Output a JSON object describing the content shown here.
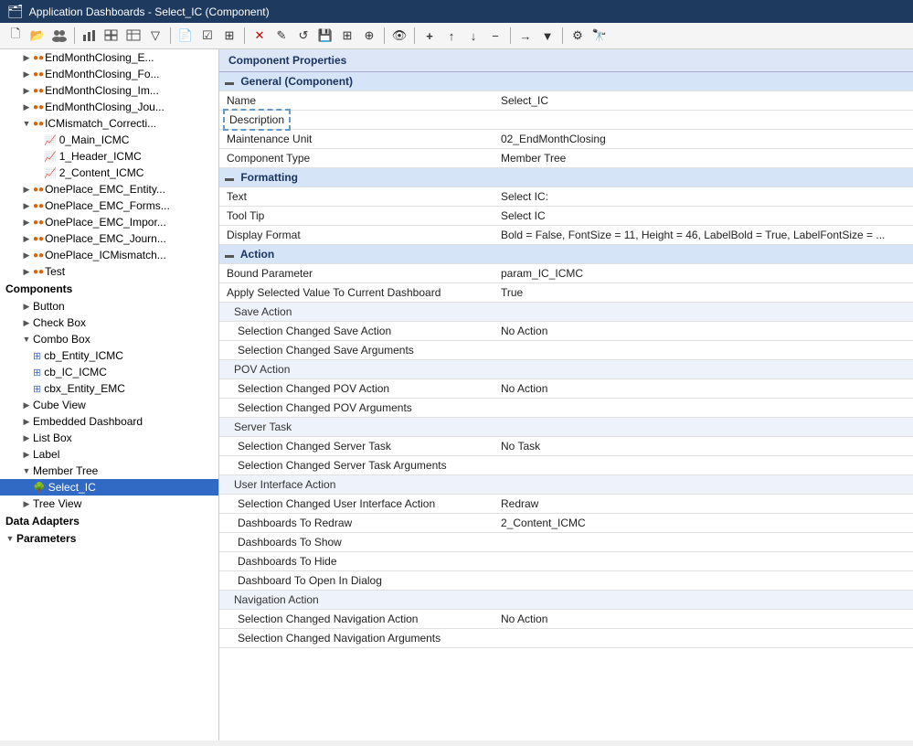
{
  "titleBar": {
    "icon": "🗂",
    "title": "Application Dashboards - Select_IC (Component)"
  },
  "toolbar": {
    "buttons": [
      {
        "name": "new",
        "icon": "🗋",
        "label": "New"
      },
      {
        "name": "open",
        "icon": "📂",
        "label": "Open"
      },
      {
        "name": "users",
        "icon": "👥",
        "label": "Users"
      },
      {
        "name": "separator1",
        "icon": "|"
      },
      {
        "name": "chart",
        "icon": "📊",
        "label": "Chart"
      },
      {
        "name": "grid",
        "icon": "⊞",
        "label": "Grid"
      },
      {
        "name": "table",
        "icon": "⊟",
        "label": "Table"
      },
      {
        "name": "filter",
        "icon": "▽",
        "label": "Filter"
      },
      {
        "name": "separator2",
        "icon": "|"
      },
      {
        "name": "doc",
        "icon": "📄",
        "label": "Document"
      },
      {
        "name": "checklist",
        "icon": "☑",
        "label": "Checklist"
      },
      {
        "name": "grid2",
        "icon": "⊞",
        "label": "Grid2"
      },
      {
        "name": "separator3",
        "icon": "|"
      },
      {
        "name": "delete",
        "icon": "✕",
        "label": "Delete"
      },
      {
        "name": "edit",
        "icon": "✎",
        "label": "Edit"
      },
      {
        "name": "refresh",
        "icon": "↺",
        "label": "Refresh"
      },
      {
        "name": "save",
        "icon": "💾",
        "label": "Save"
      },
      {
        "name": "saveall",
        "icon": "⊞",
        "label": "SaveAll"
      },
      {
        "name": "copy",
        "icon": "⊕",
        "label": "Copy"
      },
      {
        "name": "separator4",
        "icon": "|"
      },
      {
        "name": "eye",
        "icon": "👁",
        "label": "Preview"
      },
      {
        "name": "separator5",
        "icon": "|"
      },
      {
        "name": "add",
        "icon": "+",
        "label": "Add"
      },
      {
        "name": "up",
        "icon": "↑",
        "label": "Up"
      },
      {
        "name": "down",
        "icon": "↓",
        "label": "Down"
      },
      {
        "name": "minus",
        "icon": "−",
        "label": "Remove"
      },
      {
        "name": "separator6",
        "icon": "|"
      },
      {
        "name": "arrow",
        "icon": "→",
        "label": "Arrow"
      },
      {
        "name": "dropdown",
        "icon": "▼",
        "label": "Dropdown"
      },
      {
        "name": "separator7",
        "icon": "|"
      },
      {
        "name": "settings",
        "icon": "⚙",
        "label": "Settings"
      },
      {
        "name": "binoculars",
        "icon": "🔭",
        "label": "Binoculars"
      }
    ]
  },
  "tree": {
    "items": [
      {
        "id": "EndMonthClosing_E",
        "label": "EndMonthClosing_E...",
        "indent": 1,
        "type": "dots",
        "hasArrow": true,
        "expanded": false
      },
      {
        "id": "EndMonthClosing_F",
        "label": "EndMonthClosing_F...",
        "indent": 1,
        "type": "dots",
        "hasArrow": true,
        "expanded": false
      },
      {
        "id": "EndMonthClosing_Im",
        "label": "EndMonthClosing_Im...",
        "indent": 1,
        "type": "dots",
        "hasArrow": true,
        "expanded": false
      },
      {
        "id": "EndMonthClosing_Jo",
        "label": "EndMonthClosing_Jo...",
        "indent": 1,
        "type": "dots",
        "hasArrow": true,
        "expanded": false
      },
      {
        "id": "ICMismatch_Correcti",
        "label": "ICMismatch_Correcti...",
        "indent": 1,
        "type": "dots",
        "hasArrow": true,
        "expanded": true
      },
      {
        "id": "0_Main_ICMC",
        "label": "0_Main_ICMC",
        "indent": 2,
        "type": "chart",
        "hasArrow": false
      },
      {
        "id": "1_Header_ICMC",
        "label": "1_Header_ICMC",
        "indent": 2,
        "type": "chart",
        "hasArrow": false
      },
      {
        "id": "2_Content_ICMC",
        "label": "2_Content_ICMC",
        "indent": 2,
        "type": "chart",
        "hasArrow": false
      },
      {
        "id": "OnePlace_EMC_Entity",
        "label": "OnePlace_EMC_Entity...",
        "indent": 1,
        "type": "dots",
        "hasArrow": true,
        "expanded": false
      },
      {
        "id": "OnePlace_EMC_Forms",
        "label": "OnePlace_EMC_Forms...",
        "indent": 1,
        "type": "dots",
        "hasArrow": true,
        "expanded": false
      },
      {
        "id": "OnePlace_EMC_Impor",
        "label": "OnePlace_EMC_Impor...",
        "indent": 1,
        "type": "dots",
        "hasArrow": true,
        "expanded": false
      },
      {
        "id": "OnePlace_EMC_Journ",
        "label": "OnePlace_EMC_Journ...",
        "indent": 1,
        "type": "dots",
        "hasArrow": true,
        "expanded": false
      },
      {
        "id": "OnePlace_ICMismatch",
        "label": "OnePlace_ICMismatch...",
        "indent": 1,
        "type": "dots",
        "hasArrow": true,
        "expanded": false
      },
      {
        "id": "Test",
        "label": "Test",
        "indent": 1,
        "type": "dots",
        "hasArrow": true,
        "expanded": false
      },
      {
        "id": "Components",
        "label": "Components",
        "indent": 0,
        "type": "section",
        "hasArrow": false
      },
      {
        "id": "Button",
        "label": "Button",
        "indent": 1,
        "type": "folder",
        "hasArrow": true,
        "expanded": false
      },
      {
        "id": "CheckBox",
        "label": "Check Box",
        "indent": 1,
        "type": "folder",
        "hasArrow": true,
        "expanded": false
      },
      {
        "id": "ComboBox",
        "label": "Combo Box",
        "indent": 1,
        "type": "folder",
        "hasArrow": true,
        "expanded": true
      },
      {
        "id": "cb_Entity_ICMC",
        "label": "cb_Entity_ICMC",
        "indent": 2,
        "type": "combobox",
        "hasArrow": false
      },
      {
        "id": "cb_IC_ICMC",
        "label": "cb_IC_ICMC",
        "indent": 2,
        "type": "combobox",
        "hasArrow": false
      },
      {
        "id": "cbx_Entity_EMC",
        "label": "cbx_Entity_EMC",
        "indent": 2,
        "type": "combobox",
        "hasArrow": false
      },
      {
        "id": "CubeView",
        "label": "Cube View",
        "indent": 1,
        "type": "folder",
        "hasArrow": true,
        "expanded": false
      },
      {
        "id": "EmbeddedDashboard",
        "label": "Embedded Dashboard",
        "indent": 1,
        "type": "folder",
        "hasArrow": true,
        "expanded": false
      },
      {
        "id": "ListBox",
        "label": "List Box",
        "indent": 1,
        "type": "folder",
        "hasArrow": true,
        "expanded": false
      },
      {
        "id": "Label",
        "label": "Label",
        "indent": 1,
        "type": "folder",
        "hasArrow": true,
        "expanded": false
      },
      {
        "id": "MemberTree",
        "label": "Member Tree",
        "indent": 1,
        "type": "folder",
        "hasArrow": true,
        "expanded": true
      },
      {
        "id": "Select_IC",
        "label": "Select_IC",
        "indent": 2,
        "type": "membertree",
        "hasArrow": false,
        "selected": true
      },
      {
        "id": "TreeView",
        "label": "Tree View",
        "indent": 1,
        "type": "folder",
        "hasArrow": true,
        "expanded": false
      },
      {
        "id": "DataAdapters",
        "label": "Data Adapters",
        "indent": 0,
        "type": "section",
        "hasArrow": false
      },
      {
        "id": "Parameters",
        "label": "Parameters",
        "indent": 0,
        "type": "section-arrow",
        "hasArrow": true,
        "expanded": true
      }
    ]
  },
  "properties": {
    "header": "Component Properties",
    "sections": [
      {
        "id": "general",
        "label": "General (Component)",
        "collapsed": false,
        "type": "section",
        "rows": [
          {
            "name": "Name",
            "value": "Select_IC",
            "dottedOutline": false
          },
          {
            "name": "Description",
            "value": "",
            "dottedOutline": true
          },
          {
            "name": "Maintenance Unit",
            "value": "02_EndMonthClosing"
          },
          {
            "name": "Component Type",
            "value": "Member Tree"
          }
        ]
      },
      {
        "id": "formatting",
        "label": "Formatting",
        "collapsed": false,
        "type": "section",
        "rows": [
          {
            "name": "Text",
            "value": "Select IC:"
          },
          {
            "name": "Tool Tip",
            "value": "Select IC"
          },
          {
            "name": "Display Format",
            "value": "Bold = False, FontSize = 11, Height = 46, LabelBold = True, LabelFontSize = ..."
          }
        ]
      },
      {
        "id": "action",
        "label": "Action",
        "collapsed": false,
        "type": "section",
        "rows": [
          {
            "name": "Bound Parameter",
            "value": "param_IC_ICMC"
          },
          {
            "name": "Apply Selected Value To Current Dashboard",
            "value": "True"
          },
          {
            "name": "Save Action",
            "value": "",
            "subsection": true
          },
          {
            "name": "Selection Changed Save Action",
            "value": "No Action",
            "indented": true
          },
          {
            "name": "Selection Changed Save Arguments",
            "value": "",
            "indented": true
          },
          {
            "name": "POV Action",
            "value": "",
            "subsection": true
          },
          {
            "name": "Selection Changed POV Action",
            "value": "No Action",
            "indented": true
          },
          {
            "name": "Selection Changed POV Arguments",
            "value": "",
            "indented": true
          },
          {
            "name": "Server Task",
            "value": "",
            "subsection": true
          },
          {
            "name": "Selection Changed Server Task",
            "value": "No Task",
            "indented": true
          },
          {
            "name": "Selection Changed Server Task Arguments",
            "value": "",
            "indented": true
          },
          {
            "name": "User Interface Action",
            "value": "",
            "subsection": true
          },
          {
            "name": "Selection Changed User Interface Action",
            "value": "Redraw",
            "indented": true
          },
          {
            "name": "Dashboards To Redraw",
            "value": "2_Content_ICMC",
            "indented": true
          },
          {
            "name": "Dashboards To Show",
            "value": "",
            "indented": true
          },
          {
            "name": "Dashboards To Hide",
            "value": "",
            "indented": true
          },
          {
            "name": "Dashboard To Open In Dialog",
            "value": "",
            "indented": true
          },
          {
            "name": "Navigation Action",
            "value": "",
            "subsection": true
          },
          {
            "name": "Selection Changed Navigation Action",
            "value": "No Action",
            "indented": true
          },
          {
            "name": "Selection Changed Navigation Arguments",
            "value": "",
            "indented": true
          }
        ]
      }
    ]
  }
}
